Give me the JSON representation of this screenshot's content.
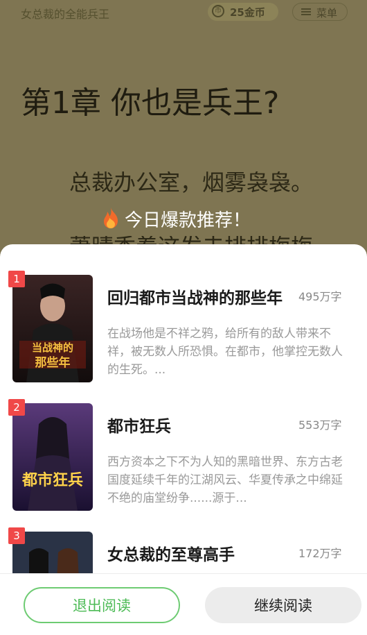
{
  "reader": {
    "book_title": "女总裁的全能兵王",
    "coin_icon_glyph": "币",
    "coins_label": "25金币",
    "menu_label": "菜单",
    "chapter_title": "第1章 你也是兵王?",
    "paragraph_1": "总裁办公室，烟雾袅袅。",
    "paragraph_2": "萧晴香着这发去排排梅梅",
    "colors": {
      "dim_background": "#7f7552",
      "text": "#1f1c10"
    }
  },
  "promo": {
    "icon": "fire-icon",
    "text": "今日爆款推荐！"
  },
  "recommendations": [
    {
      "rank": "1",
      "title": "回归都市当战神的那些年",
      "word_count": "495万字",
      "description": "在战场他是不祥之鸦，给所有的敌人带来不祥，被无数人所恐惧。在都市，他掌控无数人的生死。...",
      "cover_text": "当战神的那些年",
      "cover_colors": [
        "#2a1d1d",
        "#6b2a2a"
      ]
    },
    {
      "rank": "2",
      "title": "都市狂兵",
      "word_count": "553万字",
      "description": "西方资本之下不为人知的黑暗世界、东方古老国度延续千年的江湖风云、华夏传承之中绵延不绝的庙堂纷争......源于...",
      "cover_text": "都市狂兵",
      "cover_colors": [
        "#3a2a5a",
        "#b07ac8"
      ]
    },
    {
      "rank": "3",
      "title": "女总裁的至尊高手",
      "word_count": "172万字",
      "description": "",
      "cover_text": "",
      "cover_colors": [
        "#1e2a3a",
        "#7a8aa0"
      ]
    }
  ],
  "footer": {
    "exit_label": "退出阅读",
    "continue_label": "继续阅读",
    "colors": {
      "exit_accent": "#4dbb56",
      "continue_bg": "#ececec"
    }
  }
}
